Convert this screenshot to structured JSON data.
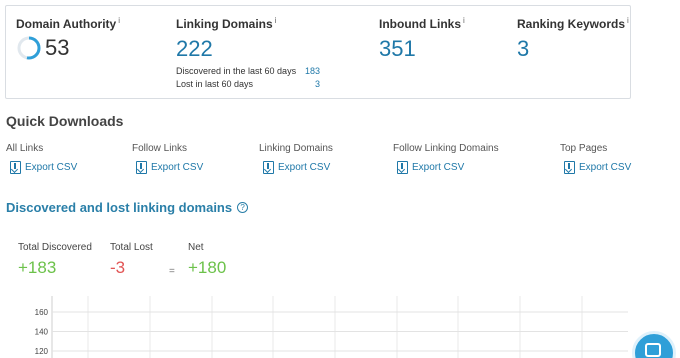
{
  "metrics": {
    "domain_authority": {
      "label": "Domain Authority",
      "info": "i",
      "value": "53"
    },
    "linking_domains": {
      "label": "Linking Domains",
      "info": "i",
      "value": "222",
      "discovered_label": "Discovered in the last 60 days",
      "discovered_value": "183",
      "lost_label": "Lost in last 60 days",
      "lost_value": "3"
    },
    "inbound_links": {
      "label": "Inbound Links",
      "info": "i",
      "value": "351"
    },
    "ranking_keywords": {
      "label": "Ranking Keywords",
      "info": "i",
      "value": "3"
    }
  },
  "quick_downloads": {
    "title": "Quick Downloads",
    "items": [
      {
        "label": "All Links",
        "action": "Export CSV"
      },
      {
        "label": "Follow Links",
        "action": "Export CSV"
      },
      {
        "label": "Linking Domains",
        "action": "Export CSV"
      },
      {
        "label": "Follow Linking Domains",
        "action": "Export CSV"
      },
      {
        "label": "Top Pages",
        "action": "Export CSV"
      }
    ]
  },
  "discovered": {
    "title": "Discovered and lost linking domains",
    "info_icon": "?",
    "total_discovered_label": "Total Discovered",
    "total_discovered_value": "+183",
    "total_lost_label": "Total Lost",
    "total_lost_value": "-3",
    "equals": "=",
    "net_label": "Net",
    "net_value": "+180"
  },
  "chart_data": {
    "type": "bar",
    "yticks": [
      "160",
      "140",
      "120"
    ],
    "ylim": [
      120,
      160
    ],
    "grid": true
  },
  "colors": {
    "accent": "#1f78a8",
    "positive": "#6cc24a",
    "negative": "#e25555"
  }
}
